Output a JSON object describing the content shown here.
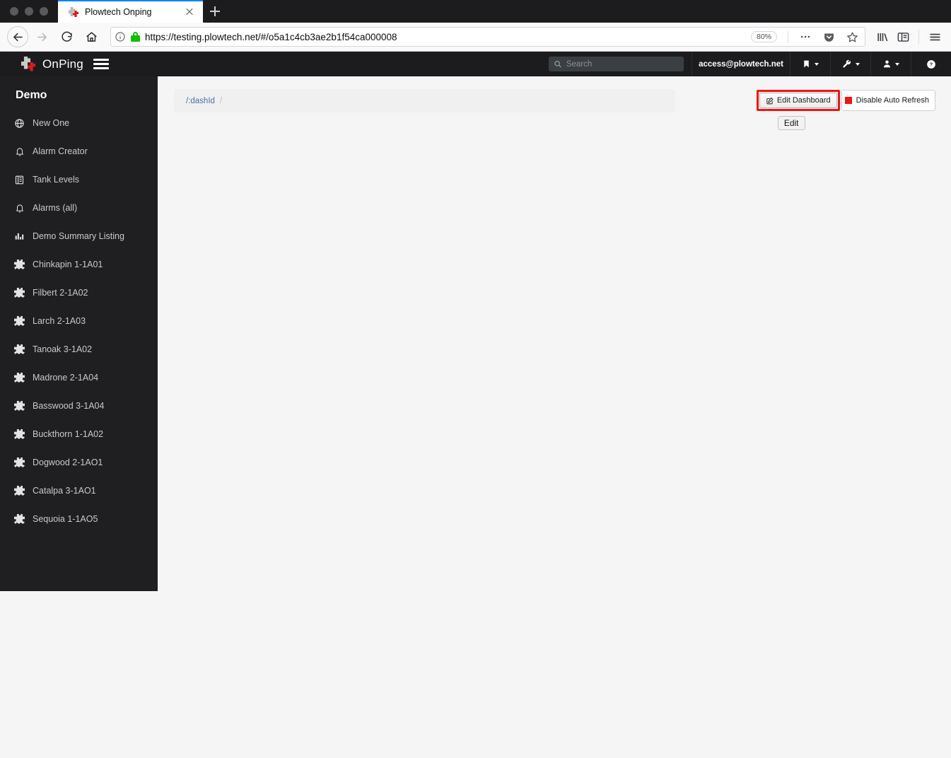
{
  "browser": {
    "tab": {
      "title": "Plowtech Onping",
      "favicon": "puzzle-favicon",
      "close_label": "×"
    },
    "newtab_label": "+",
    "nav": {
      "back": "back-arrow",
      "forward": "forward-arrow",
      "reload": "reload",
      "home": "home"
    },
    "url": {
      "scheme": "https://",
      "host": "testing.",
      "host_strong": "plowtech.net",
      "path": "/#/o5a1c4cb3ae2b1f54ca000008",
      "full": "https://testing.plowtech.net/#/o5a1c4cb3ae2b1f54ca000008"
    },
    "zoom_level": "80%",
    "toolbar_icons": [
      "page-actions-ellipsis-icon",
      "pocket-icon",
      "bookmark-star-icon",
      "library-icon",
      "sidebar-icon",
      "menu-icon"
    ]
  },
  "app_header": {
    "brand": "OnPing",
    "menu_toggle": "hamburger-icon",
    "search_placeholder": "Search",
    "search_value": "",
    "account_email": "access@plowtech.net",
    "items": [
      {
        "name": "bookmark-menu",
        "icon": "bookmark-icon",
        "caret": true
      },
      {
        "name": "tools-menu",
        "icon": "wrench-icon",
        "caret": true
      },
      {
        "name": "user-menu",
        "icon": "user-icon",
        "caret": true
      },
      {
        "name": "help-menu",
        "icon": "help-circle-icon",
        "caret": false
      }
    ]
  },
  "sidebar": {
    "title": "Demo",
    "items": [
      {
        "label": "New One",
        "icon": "globe-icon"
      },
      {
        "label": "Alarm Creator",
        "icon": "bell-icon"
      },
      {
        "label": "Tank Levels",
        "icon": "book-icon"
      },
      {
        "label": "Alarms (all)",
        "icon": "bell-icon"
      },
      {
        "label": "Demo Summary Listing",
        "icon": "bar-chart-icon"
      },
      {
        "label": "Chinkapin 1-1A01",
        "icon": "puzzle-icon"
      },
      {
        "label": "Filbert 2-1A02",
        "icon": "puzzle-icon"
      },
      {
        "label": "Larch 2-1A03",
        "icon": "puzzle-icon"
      },
      {
        "label": "Tanoak 3-1A02",
        "icon": "puzzle-icon"
      },
      {
        "label": "Madrone 2-1A04",
        "icon": "puzzle-icon"
      },
      {
        "label": "Basswood 3-1A04",
        "icon": "puzzle-icon"
      },
      {
        "label": "Buckthorn 1-1A02",
        "icon": "puzzle-icon"
      },
      {
        "label": "Dogwood 2-1AO1",
        "icon": "puzzle-icon"
      },
      {
        "label": "Catalpa 3-1AO1",
        "icon": "puzzle-icon"
      },
      {
        "label": "Sequoia 1-1AO5",
        "icon": "puzzle-icon"
      }
    ]
  },
  "content": {
    "breadcrumb": {
      "item": "/:dashId",
      "separator": "/"
    },
    "actions": {
      "edit_dashboard_label": "Edit Dashboard",
      "edit_dashboard_icon": "pencil-square-icon",
      "disable_auto_refresh_label": "Disable Auto Refresh",
      "auto_refresh_status_color": "#f01414",
      "highlight_color": "#f01414",
      "tooltip_label": "Edit"
    }
  },
  "colors": {
    "header_bg": "#1c1c1e",
    "sidebar_bg": "#1f1f21",
    "page_bg": "#f5f5f5",
    "link_blue": "#4a6fa5",
    "brand_red": "#d81a21",
    "lock_green": "#12bc00"
  }
}
